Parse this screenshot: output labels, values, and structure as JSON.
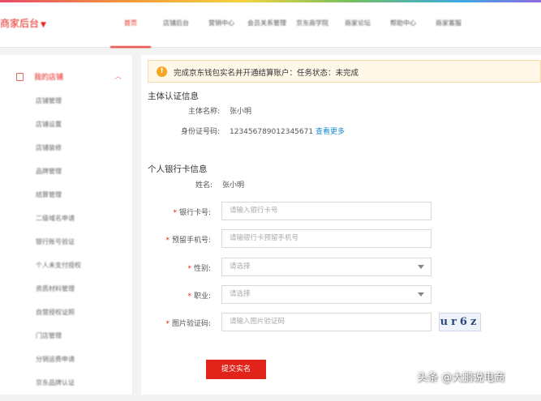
{
  "header": {
    "brand": "商家后台",
    "nav": [
      "首页",
      "店铺后台",
      "营销中心",
      "会员关系管理",
      "京东商学院",
      "商家论坛",
      "帮助中心",
      "商家客服"
    ]
  },
  "sidebar": {
    "section": "我的店铺",
    "items": [
      "店铺管理",
      "店铺设置",
      "店铺装修",
      "品牌管理",
      "结算管理",
      "二级域名申请",
      "银行账号验证",
      "个人未支付授权",
      "资质材料管理",
      "自营授权证照",
      "门店管理",
      "分销运费申请",
      "京东品牌认证"
    ]
  },
  "notice": {
    "text": "完成京东钱包实名并开通结算账户：任务状态：未完成"
  },
  "subject": {
    "title": "主体认证信息",
    "name_label": "主体名称:",
    "name_value": "张小明",
    "id_label": "身份证号码:",
    "id_value": "123456789012345671",
    "more": "查看更多"
  },
  "bank": {
    "title": "个人银行卡信息",
    "name_label": "姓名:",
    "name_value": "张小明",
    "card_label": "银行卡号:",
    "card_placeholder": "请输入银行卡号",
    "phone_label": "预留手机号:",
    "phone_placeholder": "请输银行卡预留手机号",
    "gender_label": "性别:",
    "gender_placeholder": "请选择",
    "job_label": "职业:",
    "job_placeholder": "请选择",
    "captcha_label": "图片验证码:",
    "captcha_placeholder": "请输入图片验证码",
    "captcha_text": "ur6z",
    "submit": "提交实名"
  },
  "watermark": "头条 @大鹏说电商",
  "colors": {
    "accent": "#e2231a",
    "link": "#1a8cd8",
    "warning": "#f5a623"
  }
}
